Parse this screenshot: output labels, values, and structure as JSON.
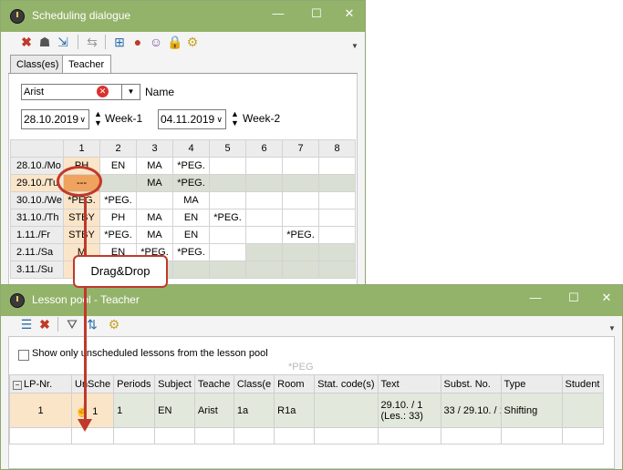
{
  "sched": {
    "title": "Scheduling dialogue",
    "min": "—",
    "max": "☐",
    "close": "✕",
    "tabs": [
      "Class(es)",
      "Teacher"
    ],
    "teacher_value": "Arist",
    "name_label": "Name",
    "date1": "28.10.2019",
    "week1": "Week-1",
    "date2": "04.11.2019",
    "week2": "Week-2",
    "cols": [
      "1",
      "2",
      "3",
      "4",
      "5",
      "6",
      "7",
      "8"
    ],
    "rows": [
      {
        "day": "28.10./Mo",
        "c": [
          "PH",
          "EN",
          "MA",
          "*PEG.",
          "",
          "",
          "",
          ""
        ]
      },
      {
        "day": "29.10./Tu",
        "c": [
          "---",
          "",
          "MA",
          "*PEG.",
          "",
          "",
          "",
          ""
        ]
      },
      {
        "day": "30.10./We",
        "c": [
          "*PEG.",
          "*PEG.",
          "",
          "MA",
          "",
          "",
          "",
          ""
        ]
      },
      {
        "day": "31.10./Th",
        "c": [
          "STBY",
          "PH",
          "MA",
          "EN",
          "*PEG.",
          "",
          "",
          ""
        ]
      },
      {
        "day": "1.11./Fr",
        "c": [
          "STBY",
          "*PEG.",
          "MA",
          "EN",
          "",
          "",
          "*PEG.",
          ""
        ]
      },
      {
        "day": "2.11./Sa",
        "c": [
          "M",
          "EN",
          "*PEG.",
          "*PEG.",
          "",
          "",
          "",
          ""
        ]
      },
      {
        "day": "3.11./Su",
        "c": [
          "",
          "",
          "",
          "",
          "",
          "",
          "",
          ""
        ]
      }
    ]
  },
  "callout": "Drag&Drop",
  "pool": {
    "title": "Lesson pool - Teacher",
    "checkbox_label": "Show only unscheduled lessons from the lesson pool",
    "peg_hint": "*PEG",
    "headers": [
      "LP-Nr.",
      "UnSche",
      "Periods",
      "Subject",
      "Teache",
      "Class(e",
      "Room",
      "Stat. code(s)",
      "Text",
      "Subst. No.",
      "Type",
      "Student"
    ],
    "row": {
      "lp": "1",
      "unsched": "1",
      "periods": "1",
      "subject": "EN",
      "teacher": "Arist",
      "class": "1a",
      "room": "R1a",
      "stat": "",
      "text1": "29.10. / 1",
      "text2": "(Les.: 33)",
      "subst": "33 / 29.10. / 1",
      "type": "Shifting",
      "student": ""
    }
  }
}
